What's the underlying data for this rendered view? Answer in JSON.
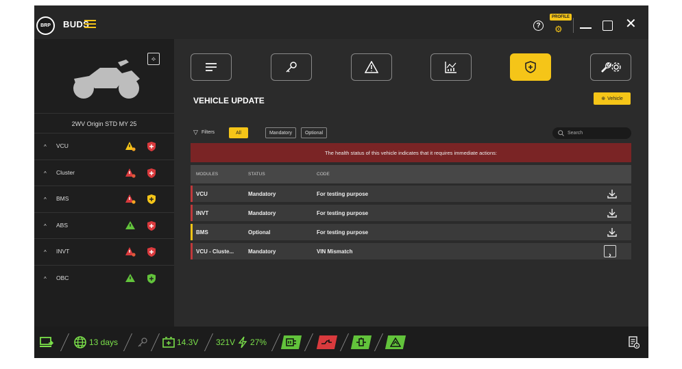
{
  "app": {
    "brand": "BUDS",
    "logo_text": "BRP"
  },
  "topbar": {
    "help_icon": "question-circle-icon",
    "profile_badge": "PROFILE",
    "profile_icon": "profile-gear-icon",
    "window_controls": [
      "minimize",
      "maximize",
      "close"
    ]
  },
  "sidebar": {
    "vehicle_image": "motorcycle-silhouette",
    "diagnostic_icon": "diagnostic-scan-icon",
    "model": "2WV Origin STD MY 25",
    "modules": [
      {
        "label": "VCU",
        "warning": "yellow",
        "shield": "red"
      },
      {
        "label": "Cluster",
        "warning": "red",
        "shield": "red"
      },
      {
        "label": "BMS",
        "warning": "red",
        "shield": "yellow"
      },
      {
        "label": "ABS",
        "warning": "green",
        "shield": "red"
      },
      {
        "label": "INVT",
        "warning": "red",
        "shield": "red"
      },
      {
        "label": "OBC",
        "warning": "green",
        "shield": "green"
      }
    ]
  },
  "tabs": [
    {
      "icon": "menu-lines-icon"
    },
    {
      "icon": "key-icon"
    },
    {
      "icon": "warning-triangle-icon"
    },
    {
      "icon": "chart-icon"
    },
    {
      "icon": "shield-plus-icon",
      "active": true
    },
    {
      "icon": "wrench-gear-icon"
    }
  ],
  "main": {
    "title": "VEHICLE UPDATE",
    "vehicle_button": "Vehicle",
    "filters_label": "Filters",
    "filter_chips": [
      "All",
      "Mandatory",
      "Optional"
    ],
    "active_filter": "All",
    "search_placeholder": "Search",
    "alert": "The health status of this vehicle indicates that it requires immediate actions:",
    "columns": [
      "MODULES",
      "STATUS",
      "CODE"
    ],
    "rows": [
      {
        "module": "VCU",
        "status": "Mandatory",
        "code": "For testing purpose",
        "action": "download",
        "flag": "#c0393b"
      },
      {
        "module": "INVT",
        "status": "Mandatory",
        "code": "For testing purpose",
        "action": "download",
        "flag": "#c0393b"
      },
      {
        "module": "BMS",
        "status": "Optional",
        "code": "For testing purpose",
        "action": "download",
        "flag": "#f5c518"
      },
      {
        "module": "VCU - Cluste...",
        "status": "Mandatory",
        "code": "VIN Mismatch",
        "action": "open",
        "flag": "#c0393b"
      }
    ]
  },
  "statusbar": {
    "connection_days": "13 days",
    "battery_voltage": "14.3V",
    "pack_voltage": "321V",
    "charge_percent": "27%"
  },
  "colors": {
    "accent": "#f5c518",
    "danger": "#c0393b",
    "ok": "#62c33b",
    "bg": "#2b2b2b"
  }
}
